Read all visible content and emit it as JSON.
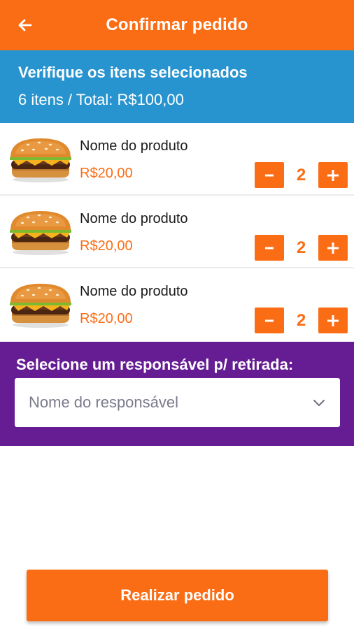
{
  "appbar": {
    "title": "Confirmar pedido",
    "back_icon": "arrow-left-icon"
  },
  "summary": {
    "heading": "Verifique os itens selecionados",
    "totals": "6 itens / Total: R$100,00"
  },
  "items": [
    {
      "name": "Nome do produto",
      "price": "R$20,00",
      "quantity": "2",
      "minus_label": "-",
      "plus_label": "+",
      "image": "burger-image"
    },
    {
      "name": "Nome do produto",
      "price": "R$20,00",
      "quantity": "2",
      "minus_label": "-",
      "plus_label": "+",
      "image": "burger-image"
    },
    {
      "name": "Nome do produto",
      "price": "R$20,00",
      "quantity": "2",
      "minus_label": "-",
      "plus_label": "+",
      "image": "burger-image"
    }
  ],
  "responsible": {
    "label": "Selecione um responsável p/ retirada:",
    "placeholder": "Nome do responsável",
    "chevron_icon": "chevron-down-icon"
  },
  "submit": {
    "label": "Realizar pedido"
  },
  "colors": {
    "orange": "#fb6d15",
    "blue": "#2794cf",
    "purple": "#661d93",
    "white": "#ffffff"
  }
}
